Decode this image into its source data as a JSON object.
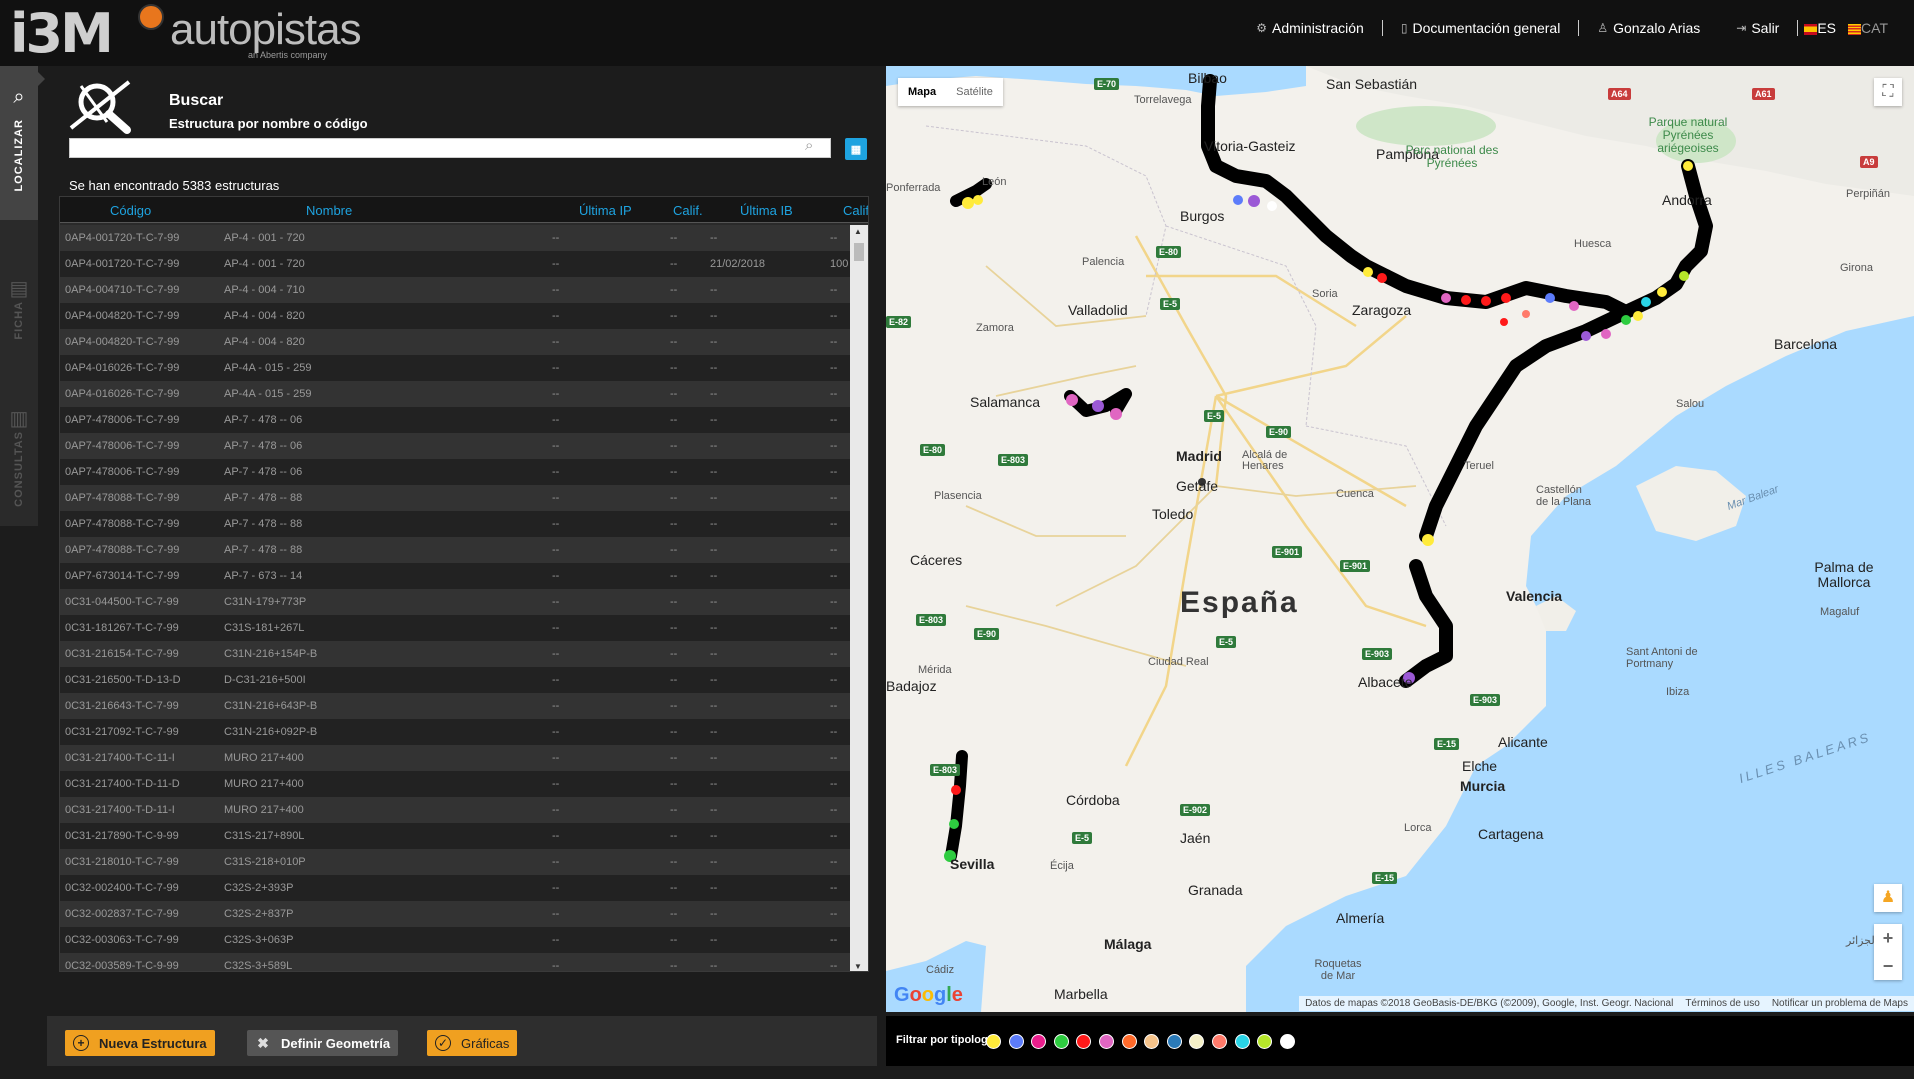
{
  "header": {
    "logo_i3m": "i3M",
    "logo_autopistas": "autopistas",
    "logo_sub": "an Abertis company",
    "nav": [
      {
        "label": "Administración",
        "icon": "gear-icon"
      },
      {
        "label": "Documentación general",
        "icon": "document-icon"
      },
      {
        "label": "Gonzalo Arias",
        "icon": "user-icon"
      },
      {
        "label": "Salir",
        "icon": "logout-icon"
      }
    ],
    "lang_es": "ES",
    "lang_cat": "CAT"
  },
  "sidebar": {
    "tabs": [
      {
        "label": "LOCALIZAR",
        "active": true
      },
      {
        "label": "FICHA",
        "active": false
      },
      {
        "label": "CONSULTAS",
        "active": false
      }
    ]
  },
  "search": {
    "title": "Buscar",
    "subtitle": "Estructura por nombre o código",
    "input_value": "",
    "placeholder": "",
    "found_text": "Se han encontrado 5383 estructuras"
  },
  "table": {
    "columns": [
      "Código",
      "Nombre",
      "Última IP",
      "Calif.",
      "Última IB",
      "Calif."
    ],
    "rows": [
      [
        "0AP4-001720-T-C-7-99",
        "AP-4 - 001 - 720",
        "--",
        "--",
        "--",
        "--"
      ],
      [
        "0AP4-001720-T-C-7-99",
        "AP-4 - 001 - 720",
        "--",
        "--",
        "21/02/2018",
        "100"
      ],
      [
        "0AP4-004710-T-C-7-99",
        "AP-4 - 004 - 710",
        "--",
        "--",
        "--",
        "--"
      ],
      [
        "0AP4-004820-T-C-7-99",
        "AP-4 - 004 - 820",
        "--",
        "--",
        "--",
        "--"
      ],
      [
        "0AP4-004820-T-C-7-99",
        "AP-4 - 004 - 820",
        "--",
        "--",
        "--",
        "--"
      ],
      [
        "0AP4-016026-T-C-7-99",
        "AP-4A - 015 - 259",
        "--",
        "--",
        "--",
        "--"
      ],
      [
        "0AP4-016026-T-C-7-99",
        "AP-4A - 015 - 259",
        "--",
        "--",
        "--",
        "--"
      ],
      [
        "0AP7-478006-T-C-7-99",
        "AP-7 - 478 -- 06",
        "--",
        "--",
        "--",
        "--"
      ],
      [
        "0AP7-478006-T-C-7-99",
        "AP-7 - 478 -- 06",
        "--",
        "--",
        "--",
        "--"
      ],
      [
        "0AP7-478006-T-C-7-99",
        "AP-7 - 478 -- 06",
        "--",
        "--",
        "--",
        "--"
      ],
      [
        "0AP7-478088-T-C-7-99",
        "AP-7 - 478 -- 88",
        "--",
        "--",
        "--",
        "--"
      ],
      [
        "0AP7-478088-T-C-7-99",
        "AP-7 - 478 -- 88",
        "--",
        "--",
        "--",
        "--"
      ],
      [
        "0AP7-478088-T-C-7-99",
        "AP-7 - 478 -- 88",
        "--",
        "--",
        "--",
        "--"
      ],
      [
        "0AP7-673014-T-C-7-99",
        "AP-7 - 673 -- 14",
        "--",
        "--",
        "--",
        "--"
      ],
      [
        "0C31-044500-T-C-7-99",
        "C31N-179+773P",
        "--",
        "--",
        "--",
        "--"
      ],
      [
        "0C31-181267-T-C-7-99",
        "C31S-181+267L",
        "--",
        "--",
        "--",
        "--"
      ],
      [
        "0C31-216154-T-C-7-99",
        "C31N-216+154P-B",
        "--",
        "--",
        "--",
        "--"
      ],
      [
        "0C31-216500-T-D-13-D",
        "D-C31-216+500I",
        "--",
        "--",
        "--",
        "--"
      ],
      [
        "0C31-216643-T-C-7-99",
        "C31N-216+643P-B",
        "--",
        "--",
        "--",
        "--"
      ],
      [
        "0C31-217092-T-C-7-99",
        "C31N-216+092P-B",
        "--",
        "--",
        "--",
        "--"
      ],
      [
        "0C31-217400-T-C-11-I",
        "MURO 217+400",
        "--",
        "--",
        "--",
        "--"
      ],
      [
        "0C31-217400-T-D-11-D",
        "MURO 217+400",
        "--",
        "--",
        "--",
        "--"
      ],
      [
        "0C31-217400-T-D-11-I",
        "MURO 217+400",
        "--",
        "--",
        "--",
        "--"
      ],
      [
        "0C31-217890-T-C-9-99",
        "C31S-217+890L",
        "--",
        "--",
        "--",
        "--"
      ],
      [
        "0C31-218010-T-C-7-99",
        "C31S-218+010P",
        "--",
        "--",
        "--",
        "--"
      ],
      [
        "0C32-002400-T-C-7-99",
        "C32S-2+393P",
        "--",
        "--",
        "--",
        "--"
      ],
      [
        "0C32-002837-T-C-7-99",
        "C32S-2+837P",
        "--",
        "--",
        "--",
        "--"
      ],
      [
        "0C32-003063-T-C-7-99",
        "C32S-3+063P",
        "--",
        "--",
        "--",
        "--"
      ],
      [
        "0C32-003589-T-C-9-99",
        "C32S-3+589L",
        "--",
        "--",
        "--",
        "--"
      ]
    ]
  },
  "actions": {
    "nueva": "Nueva Estructura",
    "definir": "Definir Geometría",
    "graficas": "Gráficas"
  },
  "map": {
    "type_map": "Mapa",
    "type_sat": "Satélite",
    "country": "España",
    "attribution": "Datos de mapas ©2018 GeoBasis-DE/BKG (©2009), Google, Inst. Geogr. Nacional",
    "terms": "Términos de uso",
    "report": "Notificar un problema de Maps",
    "google": "Google",
    "labels": {
      "bilbao": "Bilbao",
      "sansebastian": "San Sebastián",
      "torrelavega": "Torrelavega",
      "vitoria": "Vitoria-Gasteiz",
      "pamplona": "Pamplona",
      "parc": "Parc national des Pyrénées",
      "parque": "Parque natural Pyrénées ariégeoises",
      "andorra": "Andorra",
      "perpignan": "Perpiñán",
      "burgos": "Burgos",
      "huesca": "Huesca",
      "ponferrada": "Ponferrada",
      "leon": "León",
      "palencia": "Palencia",
      "valladolid": "Valladolid",
      "zaragoza": "Zaragoza",
      "soria": "Soria",
      "girona": "Girona",
      "barcelona": "Barcelona",
      "zamora": "Zamora",
      "salamanca": "Salamanca",
      "salou": "Salou",
      "madrid": "Madrid",
      "alcala": "Alcalá de Henares",
      "getafe": "Getafe",
      "teruel": "Teruel",
      "plasencia": "Plasencia",
      "toledo": "Toledo",
      "cuenca": "Cuenca",
      "castellon": "Castellón de la Plana",
      "marbalear": "Mar Balear",
      "palma": "Palma de Mallorca",
      "magaluf": "Magaluf",
      "caceres": "Cáceres",
      "valencia": "Valencia",
      "merida": "Mérida",
      "badajoz": "Badajoz",
      "ciudadreal": "Ciudad Real",
      "albacete": "Albacete",
      "santantoni": "Sant Antoni de Portmany",
      "ibiza": "Ibiza",
      "illes": "ILLES BALEARS",
      "alicante": "Alicante",
      "elche": "Elche",
      "murcia": "Murcia",
      "cordoba": "Córdoba",
      "cartagena": "Cartagena",
      "lorca": "Lorca",
      "jaen": "Jaén",
      "sevilla": "Sevilla",
      "ecija": "Écija",
      "granada": "Granada",
      "almeria": "Almería",
      "malaga": "Málaga",
      "roquetas": "Roquetas de Mar",
      "marbella": "Marbella",
      "cadiz": "Cádiz",
      "argel": "الجزائر"
    },
    "roads": [
      "E-70",
      "A64",
      "A61",
      "A9",
      "E-80",
      "E-5",
      "E-5",
      "E-90",
      "E-80",
      "E-803",
      "E-901",
      "E-901",
      "E-90",
      "E-803",
      "E-5",
      "E-903",
      "E-903",
      "E-803",
      "E-902",
      "E-5",
      "E-15",
      "E-15",
      "E-82"
    ]
  },
  "filter": {
    "label": "Filtrar por tipología",
    "colors": [
      "#ffeb3b",
      "#5c7cfa",
      "#e91e8c",
      "#2ecc40",
      "#ff1a1a",
      "#e066c2",
      "#ff6a2a",
      "#f5c38a",
      "#2a7ab8",
      "#f5f0c8",
      "#ff7a6a",
      "#2ad4e6",
      "#b6e62a",
      "#ffffff"
    ]
  }
}
